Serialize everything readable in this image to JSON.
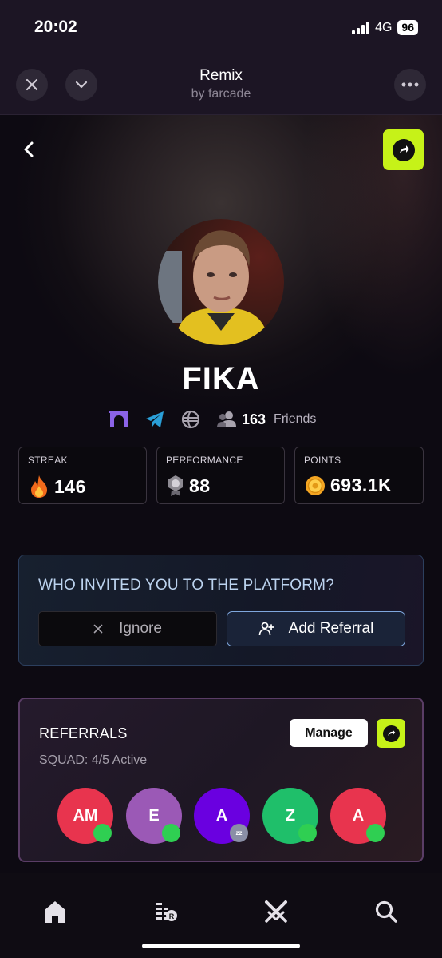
{
  "status_bar": {
    "time": "20:02",
    "network": "4G",
    "battery": "96"
  },
  "nav": {
    "title": "Remix",
    "subtitle": "by farcade"
  },
  "profile": {
    "username": "FIKA",
    "friends_count": "163",
    "friends_label": "Friends"
  },
  "stats": [
    {
      "label": "STREAK",
      "value": "146",
      "icon": "fire-icon"
    },
    {
      "label": "PERFORMANCE",
      "value": "88",
      "icon": "medal-icon"
    },
    {
      "label": "POINTS",
      "value": "693.1K",
      "icon": "coin-icon"
    }
  ],
  "invite": {
    "title": "WHO INVITED YOU TO THE PLATFORM?",
    "ignore_label": "Ignore",
    "add_label": "Add Referral"
  },
  "referrals": {
    "title": "REFERRALS",
    "squad": "SQUAD: 4/5 Active",
    "manage_label": "Manage",
    "members": [
      {
        "initials": "AM",
        "color": "#e8344e",
        "status": "online"
      },
      {
        "initials": "E",
        "color": "#9b59b6",
        "status": "online"
      },
      {
        "initials": "A",
        "color": "#6a00e0",
        "status": "sleeping"
      },
      {
        "initials": "Z",
        "color": "#1fbf6a",
        "status": "online"
      },
      {
        "initials": "A",
        "color": "#e8344e",
        "status": "online"
      }
    ]
  },
  "tabs": [
    {
      "icon": "home-icon"
    },
    {
      "icon": "leaderboard-icon"
    },
    {
      "icon": "swords-icon"
    },
    {
      "icon": "search-icon"
    }
  ],
  "colors": {
    "accent": "#c6f218",
    "online": "#2fcf52",
    "background": "#0d0a12"
  }
}
